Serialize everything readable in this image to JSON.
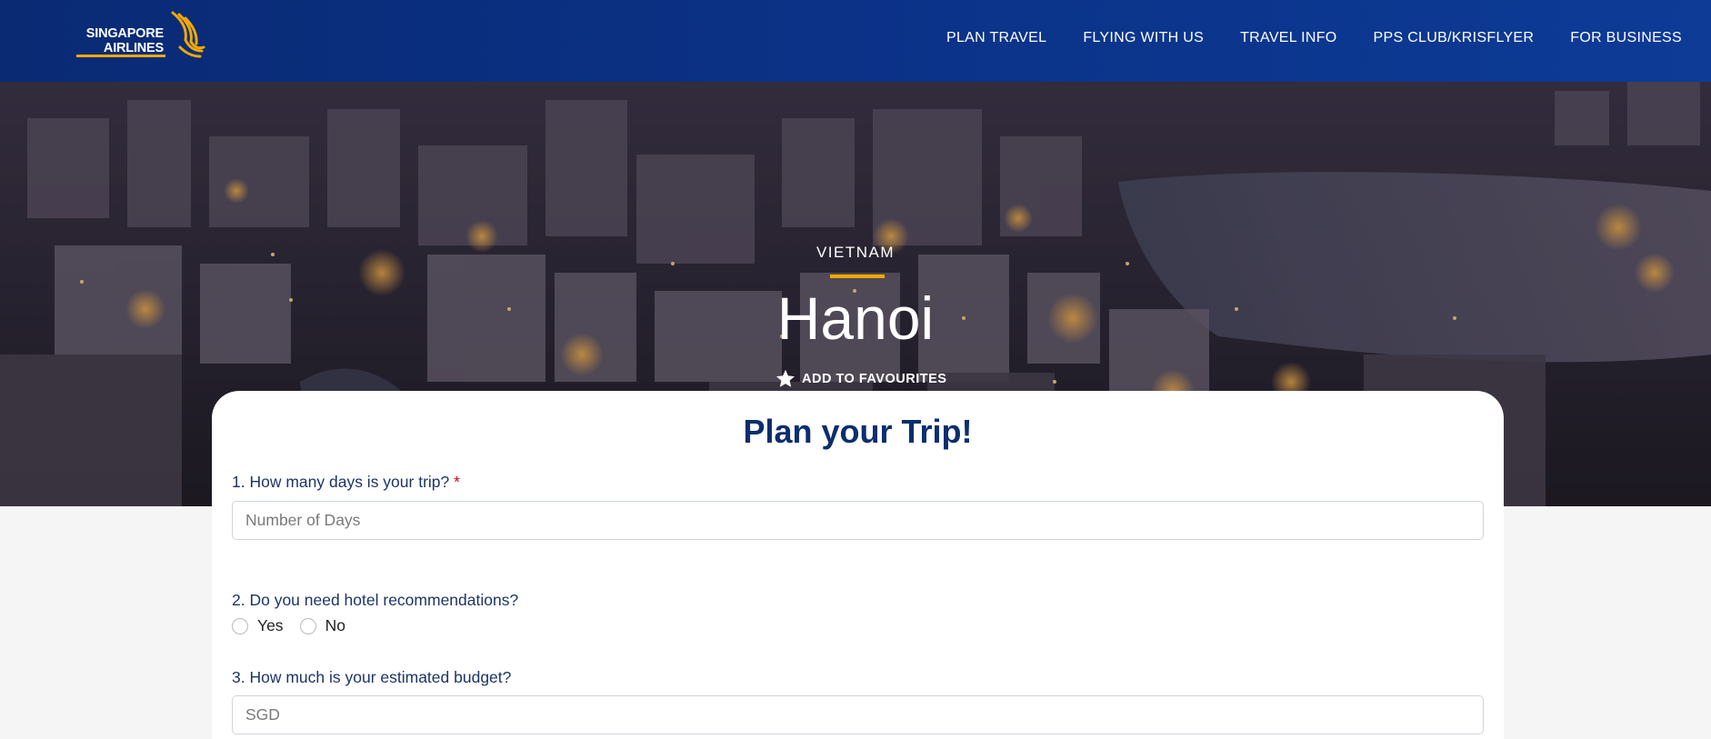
{
  "header": {
    "logo": {
      "line1": "SINGAPORE",
      "line2": "AIRLINES",
      "icon": "sia-bird-logo",
      "accent_color": "#f2a900"
    },
    "nav": [
      {
        "label": "PLAN TRAVEL"
      },
      {
        "label": "FLYING WITH US"
      },
      {
        "label": "TRAVEL INFO"
      },
      {
        "label": "PPS CLUB/KRISFLYER"
      },
      {
        "label": "FOR BUSINESS"
      }
    ],
    "background_color": "#0b3389"
  },
  "hero": {
    "country": "VIETNAM",
    "city": "Hanoi",
    "favourites_label": "ADD TO FAVOURITES",
    "favourites_icon": "star-icon"
  },
  "form": {
    "title": "Plan your Trip!",
    "q1": {
      "label": "1. How many days is your trip?",
      "required_mark": "*",
      "placeholder": "Number of Days",
      "value": ""
    },
    "q2": {
      "label": "2. Do you need hotel recommendations?",
      "options": [
        "Yes",
        "No"
      ],
      "selected": null
    },
    "q3": {
      "label": "3. How much is your estimated budget?",
      "placeholder": "SGD",
      "value": ""
    }
  },
  "colors": {
    "brand_navy": "#0b2e6f",
    "brand_gold": "#f2a900",
    "required_red": "#d0021b"
  }
}
